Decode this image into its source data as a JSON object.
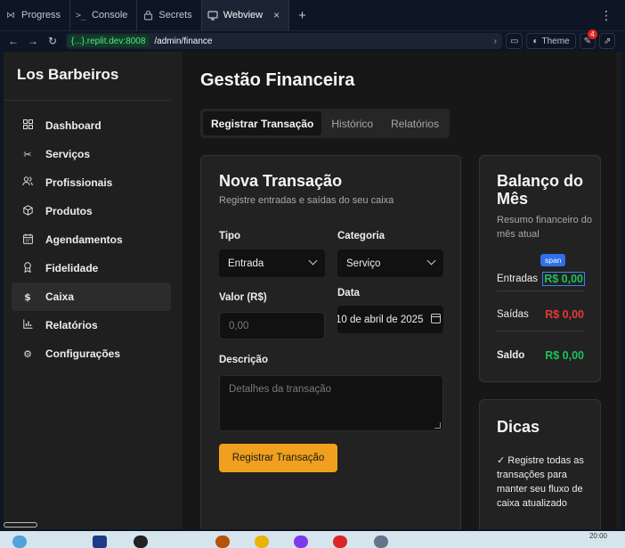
{
  "workspace_tabs": [
    {
      "label": "Progress",
      "icon": "progress-icon",
      "active": false
    },
    {
      "label": "Console",
      "icon": "console-icon",
      "active": false
    },
    {
      "label": "Secrets",
      "icon": "lock-icon",
      "active": false
    },
    {
      "label": "Webview",
      "icon": "monitor-icon",
      "active": true
    }
  ],
  "urlbar": {
    "host": "{...}.replit.dev:8008",
    "path": "/admin/finance",
    "theme_label": "Theme",
    "notification_count": "4"
  },
  "sidebar": {
    "brand": "Los Barbeiros",
    "items": [
      {
        "label": "Dashboard",
        "icon": "dashboard-icon",
        "active": false
      },
      {
        "label": "Serviços",
        "icon": "scissors-icon",
        "active": false
      },
      {
        "label": "Profissionais",
        "icon": "users-icon",
        "active": false
      },
      {
        "label": "Produtos",
        "icon": "box-icon",
        "active": false
      },
      {
        "label": "Agendamentos",
        "icon": "calendar-icon",
        "active": false
      },
      {
        "label": "Fidelidade",
        "icon": "award-icon",
        "active": false
      },
      {
        "label": "Caixa",
        "icon": "dollar-icon",
        "active": true
      },
      {
        "label": "Relatórios",
        "icon": "chart-icon",
        "active": false
      },
      {
        "label": "Configurações",
        "icon": "gear-icon",
        "active": false
      }
    ]
  },
  "main": {
    "title": "Gestão Financeira",
    "tabs": [
      "Registrar Transação",
      "Histórico",
      "Relatórios"
    ],
    "form": {
      "title": "Nova Transação",
      "subtitle": "Registre entradas e saídas do seu caixa",
      "tipo_label": "Tipo",
      "tipo_value": "Entrada",
      "categoria_label": "Categoria",
      "categoria_value": "Serviço",
      "valor_label": "Valor (R$)",
      "valor_placeholder": "0,00",
      "data_label": "Data",
      "data_value": "10 de abril de 2025",
      "descricao_label": "Descrição",
      "descricao_placeholder": "Detalhes da transação",
      "submit_label": "Registrar Transação"
    },
    "balance": {
      "title": "Balanço do Mês",
      "subtitle": "Resumo financeiro do mês atual",
      "entradas_label": "Entradas",
      "entradas_value": "R$ 0,00",
      "saidas_label": "Saídas",
      "saidas_value": "R$ 0,00",
      "saldo_label": "Saldo",
      "saldo_value": "R$ 0,00",
      "inspector_tag": "span"
    },
    "tips": {
      "title": "Dicas",
      "text": "✓ Registre todas as transações para manter seu fluxo de caixa atualizado"
    }
  },
  "colors": {
    "accent": "#f0a01e",
    "positive": "#1fbf5a",
    "negative": "#e53935",
    "background": "#171717"
  },
  "taskbar": {
    "clock": "20:00"
  }
}
